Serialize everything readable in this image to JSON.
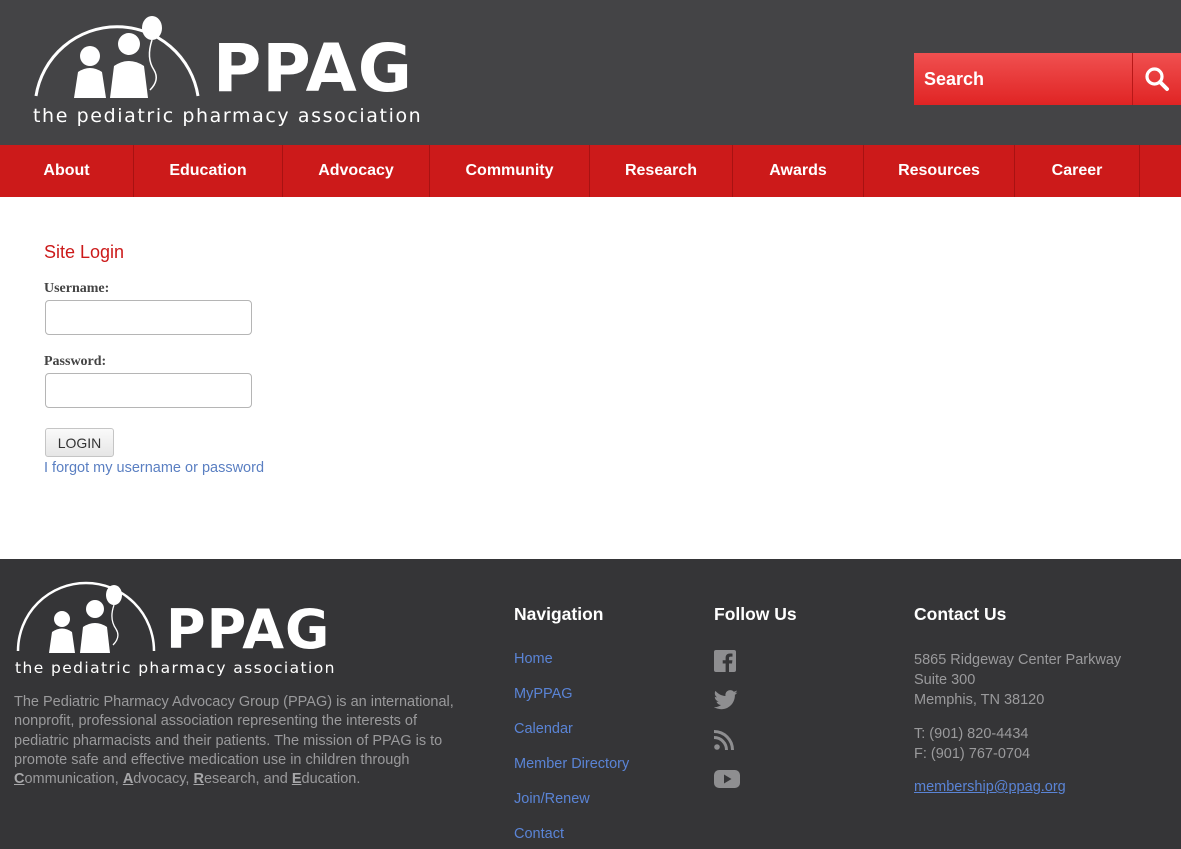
{
  "header": {
    "logo_text": "PPAG",
    "logo_tagline": "the pediatric pharmacy association",
    "search_placeholder": "Search"
  },
  "nav": {
    "items": [
      {
        "label": "About"
      },
      {
        "label": "Education"
      },
      {
        "label": "Advocacy"
      },
      {
        "label": "Community"
      },
      {
        "label": "Research"
      },
      {
        "label": "Awards"
      },
      {
        "label": "Resources"
      },
      {
        "label": "Career"
      }
    ]
  },
  "login": {
    "title": "Site Login",
    "username_label": "Username:",
    "username_value": "",
    "password_label": "Password:",
    "password_value": "",
    "button_label": "LOGIN",
    "forgot_link": "I forgot my username or password"
  },
  "footer": {
    "logo_text": "PPAG",
    "logo_tagline": "the pediatric pharmacy association",
    "about_prefix": "The Pediatric Pharmacy Advocacy Group (PPAG) is an international, nonprofit, professional association representing the interests of pediatric pharmacists and their patients. The mission of PPAG is to promote safe and effective medication use in children through ",
    "about_c": "C",
    "about_c_rest": "ommunication, ",
    "about_a": "A",
    "about_a_rest": "dvocacy, ",
    "about_r": "R",
    "about_r_rest": "esearch, and ",
    "about_e": "E",
    "about_e_rest": "ducation.",
    "nav_heading": "Navigation",
    "nav_links": [
      "Home",
      "MyPPAG",
      "Calendar",
      "Member Directory",
      "Join/Renew",
      "Contact"
    ],
    "follow_heading": "Follow Us",
    "social_icons": [
      "facebook-icon",
      "twitter-icon",
      "rss-icon",
      "youtube-icon"
    ],
    "contact_heading": "Contact Us",
    "address_line1": "5865 Ridgeway Center Parkway",
    "address_line2": "Suite 300",
    "address_line3": "Memphis, TN 38120",
    "phone": "T: (901) 820-4434",
    "fax": "F: (901) 767-0704",
    "email": "membership@ppag.org"
  },
  "colors": {
    "header_bg": "#444446",
    "nav_red": "#cc1a1a",
    "search_red": "#e83434",
    "footer_bg": "#353537",
    "link_blue": "#5a84d6"
  }
}
